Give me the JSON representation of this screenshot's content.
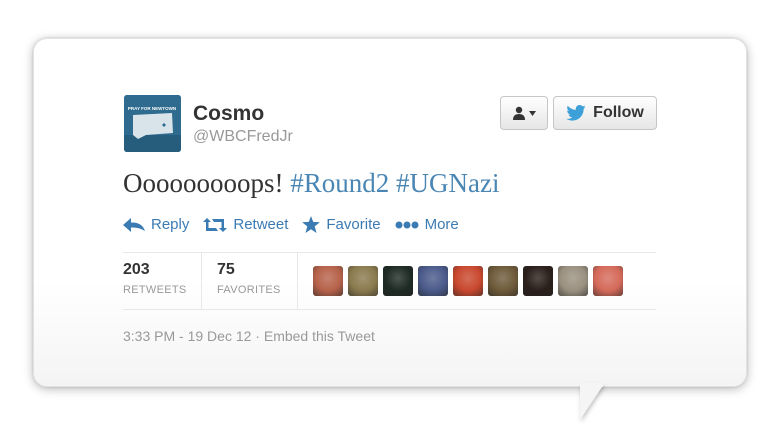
{
  "user": {
    "name": "Cosmo",
    "handle": "@WBCFredJr",
    "avatar_text": "PRAY FOR NEWTOWN"
  },
  "buttons": {
    "follow_label": "Follow"
  },
  "tweet": {
    "text_plain": "Ooooooooops!",
    "hashtags": [
      "#Round2",
      "#UGNazi"
    ]
  },
  "actions": [
    {
      "label": "Reply",
      "icon": "reply-icon"
    },
    {
      "label": "Retweet",
      "icon": "retweet-icon"
    },
    {
      "label": "Favorite",
      "icon": "star-icon"
    },
    {
      "label": "More",
      "icon": "more-dots-icon"
    }
  ],
  "stats": {
    "retweets": {
      "value": "203",
      "label": "RETWEETS"
    },
    "favorites": {
      "value": "75",
      "label": "FAVORITES"
    }
  },
  "favoriters": [
    {
      "color": "#b6624a"
    },
    {
      "color": "#8a7a4e"
    },
    {
      "color": "#1e2a24"
    },
    {
      "color": "#4a5a8a"
    },
    {
      "color": "#c8482e"
    },
    {
      "color": "#6e5a3a"
    },
    {
      "color": "#2a1f1a"
    },
    {
      "color": "#9a9080"
    },
    {
      "color": "#d46a5a"
    }
  ],
  "footer": {
    "timestamp": "3:33 PM - 19 Dec 12",
    "separator": "·",
    "embed_label": "Embed this Tweet"
  },
  "colors": {
    "link": "#3b7bb3",
    "hashtag": "#4a86b4",
    "twitter_bird": "#1da1f2"
  }
}
